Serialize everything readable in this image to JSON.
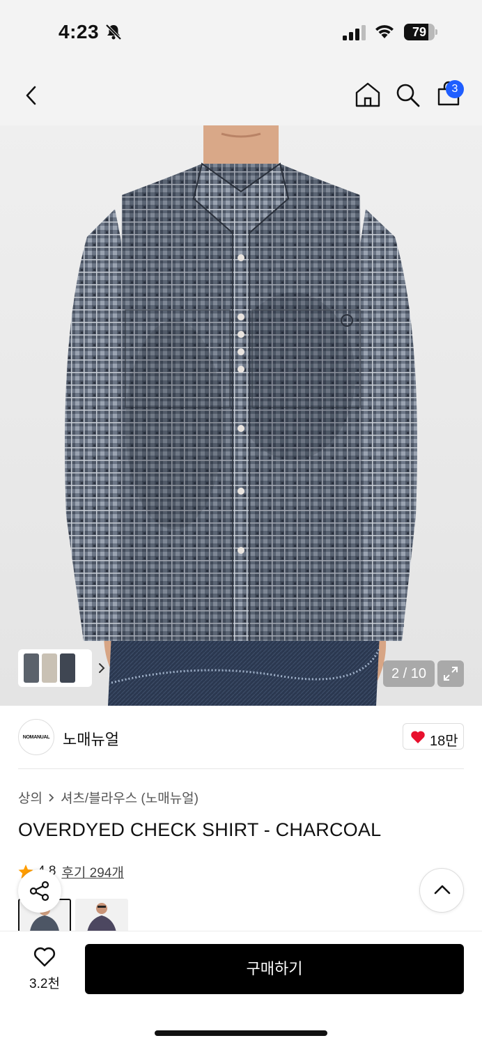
{
  "status_bar": {
    "time": "4:23",
    "battery_level": "79"
  },
  "nav": {
    "cart_count": "3"
  },
  "gallery": {
    "counter": "2 / 10"
  },
  "brand": {
    "logo_text": "NOMANUAL",
    "name": "노매뉴얼",
    "likes": "18만"
  },
  "product": {
    "breadcrumb": {
      "category": "상의",
      "subcategory": "셔츠/블라우스 (노매뉴얼)"
    },
    "title": "OVERDYED CHECK SHIRT - CHARCOAL",
    "rating": "4.8",
    "review_link": "후기 294개"
  },
  "bottom_bar": {
    "wish_count": "3.2천",
    "buy_label": "구매하기"
  },
  "colors": {
    "badge": "#1f5eff",
    "heart": "#e8102d",
    "star": "#ff9d00",
    "buy_button": "#000000"
  }
}
